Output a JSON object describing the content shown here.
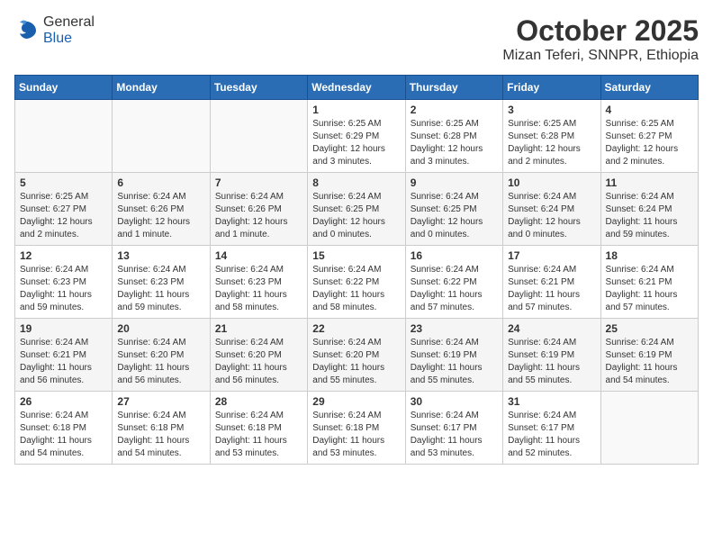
{
  "logo": {
    "general": "General",
    "blue": "Blue"
  },
  "title": "October 2025",
  "subtitle": "Mizan Teferi, SNNPR, Ethiopia",
  "days_of_week": [
    "Sunday",
    "Monday",
    "Tuesday",
    "Wednesday",
    "Thursday",
    "Friday",
    "Saturday"
  ],
  "weeks": [
    [
      {
        "day": "",
        "info": ""
      },
      {
        "day": "",
        "info": ""
      },
      {
        "day": "",
        "info": ""
      },
      {
        "day": "1",
        "info": "Sunrise: 6:25 AM\nSunset: 6:29 PM\nDaylight: 12 hours\nand 3 minutes."
      },
      {
        "day": "2",
        "info": "Sunrise: 6:25 AM\nSunset: 6:28 PM\nDaylight: 12 hours\nand 3 minutes."
      },
      {
        "day": "3",
        "info": "Sunrise: 6:25 AM\nSunset: 6:28 PM\nDaylight: 12 hours\nand 2 minutes."
      },
      {
        "day": "4",
        "info": "Sunrise: 6:25 AM\nSunset: 6:27 PM\nDaylight: 12 hours\nand 2 minutes."
      }
    ],
    [
      {
        "day": "5",
        "info": "Sunrise: 6:25 AM\nSunset: 6:27 PM\nDaylight: 12 hours\nand 2 minutes."
      },
      {
        "day": "6",
        "info": "Sunrise: 6:24 AM\nSunset: 6:26 PM\nDaylight: 12 hours\nand 1 minute."
      },
      {
        "day": "7",
        "info": "Sunrise: 6:24 AM\nSunset: 6:26 PM\nDaylight: 12 hours\nand 1 minute."
      },
      {
        "day": "8",
        "info": "Sunrise: 6:24 AM\nSunset: 6:25 PM\nDaylight: 12 hours\nand 0 minutes."
      },
      {
        "day": "9",
        "info": "Sunrise: 6:24 AM\nSunset: 6:25 PM\nDaylight: 12 hours\nand 0 minutes."
      },
      {
        "day": "10",
        "info": "Sunrise: 6:24 AM\nSunset: 6:24 PM\nDaylight: 12 hours\nand 0 minutes."
      },
      {
        "day": "11",
        "info": "Sunrise: 6:24 AM\nSunset: 6:24 PM\nDaylight: 11 hours\nand 59 minutes."
      }
    ],
    [
      {
        "day": "12",
        "info": "Sunrise: 6:24 AM\nSunset: 6:23 PM\nDaylight: 11 hours\nand 59 minutes."
      },
      {
        "day": "13",
        "info": "Sunrise: 6:24 AM\nSunset: 6:23 PM\nDaylight: 11 hours\nand 59 minutes."
      },
      {
        "day": "14",
        "info": "Sunrise: 6:24 AM\nSunset: 6:23 PM\nDaylight: 11 hours\nand 58 minutes."
      },
      {
        "day": "15",
        "info": "Sunrise: 6:24 AM\nSunset: 6:22 PM\nDaylight: 11 hours\nand 58 minutes."
      },
      {
        "day": "16",
        "info": "Sunrise: 6:24 AM\nSunset: 6:22 PM\nDaylight: 11 hours\nand 57 minutes."
      },
      {
        "day": "17",
        "info": "Sunrise: 6:24 AM\nSunset: 6:21 PM\nDaylight: 11 hours\nand 57 minutes."
      },
      {
        "day": "18",
        "info": "Sunrise: 6:24 AM\nSunset: 6:21 PM\nDaylight: 11 hours\nand 57 minutes."
      }
    ],
    [
      {
        "day": "19",
        "info": "Sunrise: 6:24 AM\nSunset: 6:21 PM\nDaylight: 11 hours\nand 56 minutes."
      },
      {
        "day": "20",
        "info": "Sunrise: 6:24 AM\nSunset: 6:20 PM\nDaylight: 11 hours\nand 56 minutes."
      },
      {
        "day": "21",
        "info": "Sunrise: 6:24 AM\nSunset: 6:20 PM\nDaylight: 11 hours\nand 56 minutes."
      },
      {
        "day": "22",
        "info": "Sunrise: 6:24 AM\nSunset: 6:20 PM\nDaylight: 11 hours\nand 55 minutes."
      },
      {
        "day": "23",
        "info": "Sunrise: 6:24 AM\nSunset: 6:19 PM\nDaylight: 11 hours\nand 55 minutes."
      },
      {
        "day": "24",
        "info": "Sunrise: 6:24 AM\nSunset: 6:19 PM\nDaylight: 11 hours\nand 55 minutes."
      },
      {
        "day": "25",
        "info": "Sunrise: 6:24 AM\nSunset: 6:19 PM\nDaylight: 11 hours\nand 54 minutes."
      }
    ],
    [
      {
        "day": "26",
        "info": "Sunrise: 6:24 AM\nSunset: 6:18 PM\nDaylight: 11 hours\nand 54 minutes."
      },
      {
        "day": "27",
        "info": "Sunrise: 6:24 AM\nSunset: 6:18 PM\nDaylight: 11 hours\nand 54 minutes."
      },
      {
        "day": "28",
        "info": "Sunrise: 6:24 AM\nSunset: 6:18 PM\nDaylight: 11 hours\nand 53 minutes."
      },
      {
        "day": "29",
        "info": "Sunrise: 6:24 AM\nSunset: 6:18 PM\nDaylight: 11 hours\nand 53 minutes."
      },
      {
        "day": "30",
        "info": "Sunrise: 6:24 AM\nSunset: 6:17 PM\nDaylight: 11 hours\nand 53 minutes."
      },
      {
        "day": "31",
        "info": "Sunrise: 6:24 AM\nSunset: 6:17 PM\nDaylight: 11 hours\nand 52 minutes."
      },
      {
        "day": "",
        "info": ""
      }
    ]
  ]
}
